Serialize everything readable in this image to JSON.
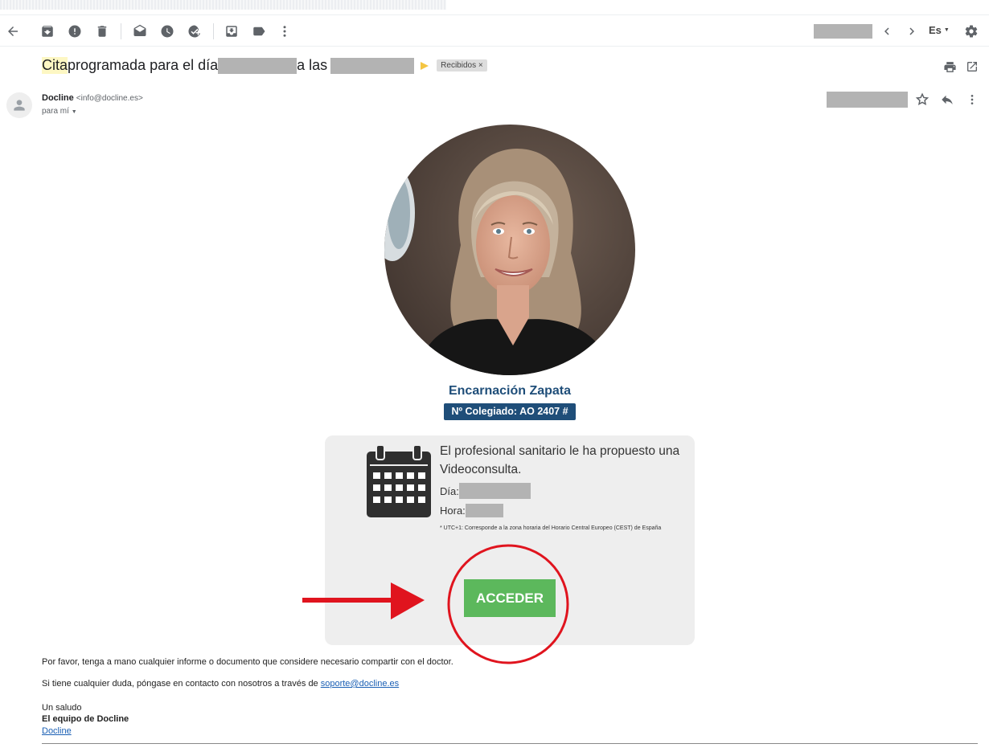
{
  "toolbar": {
    "icons": [
      "back-icon",
      "archive-icon",
      "report-spam-icon",
      "delete-icon",
      "mark-unread-icon",
      "snooze-icon",
      "add-task-icon",
      "move-to-icon",
      "label-icon",
      "more-icon"
    ],
    "language": "Es",
    "nav_icons": [
      "prev-icon",
      "next-icon",
      "settings-icon"
    ]
  },
  "subject": {
    "highlight": "Cita",
    "text_a": " programada para el día",
    "text_b": "a las",
    "label": "Recibidos",
    "label_close": "×"
  },
  "sender": {
    "name": "Docline",
    "email": "<info@docline.es>",
    "to": "para mí"
  },
  "email_body": {
    "doctor_name": "Encarnación Zapata",
    "colegiado": "Nº Colegiado: AO 2407 #",
    "proposal": "El profesional sanitario le ha propuesto una Videoconsulta.",
    "day_label": "Día:",
    "time_label": "Hora:",
    "footnote": "* UTC+1: Corresponde a la zona horaria del Horario Central Europeo (CEST) de España",
    "button": "ACCEDER",
    "para1": "Por favor, tenga a mano cualquier informe o documento que considere necesario compartir con el doctor.",
    "para2_prefix": "Si tiene cualquier duda, póngase en contacto con nosotros a través de ",
    "support_email": "soporte@docline.es",
    "greeting": "Un saludo",
    "team": "El equipo de Docline",
    "brand_link": "Docline"
  },
  "colors": {
    "accent_blue": "#1f4e79",
    "button_green": "#5cb85c",
    "annotation_red": "#e0141e"
  }
}
